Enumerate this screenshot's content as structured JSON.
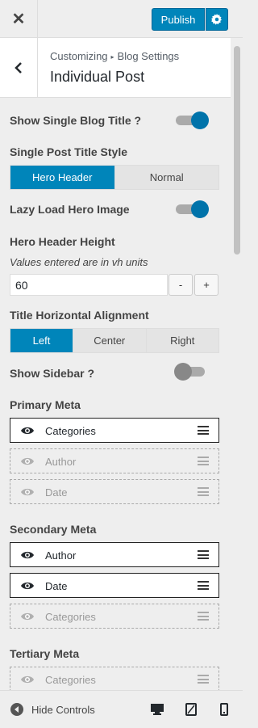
{
  "topbar": {
    "close_icon": "close-icon",
    "publish_label": "Publish",
    "settings_icon": "gear-icon",
    "accent_color": "#0085ba"
  },
  "header": {
    "breadcrumb_root": "Customizing",
    "breadcrumb_section": "Blog Settings",
    "title": "Individual Post",
    "back_icon": "chevron-left-icon"
  },
  "controls": {
    "show_single_blog_title": {
      "label": "Show Single Blog Title ?",
      "value": true
    },
    "single_post_title_style": {
      "label": "Single Post Title Style",
      "options": [
        "Hero Header",
        "Normal"
      ],
      "selected": "Hero Header"
    },
    "lazy_load_hero_image": {
      "label": "Lazy Load Hero Image",
      "value": true
    },
    "hero_header_height": {
      "label": "Hero Header Height",
      "description": "Values entered are in vh units",
      "value": "60",
      "decrement": "-",
      "increment": "+"
    },
    "title_horizontal_alignment": {
      "label": "Title Horizontal Alignment",
      "options": [
        "Left",
        "Center",
        "Right"
      ],
      "selected": "Left"
    },
    "show_sidebar": {
      "label": "Show Sidebar ?",
      "value": false
    }
  },
  "meta": {
    "primary": {
      "label": "Primary Meta",
      "items": [
        {
          "label": "Categories",
          "enabled": true
        },
        {
          "label": "Author",
          "enabled": false
        },
        {
          "label": "Date",
          "enabled": false
        }
      ]
    },
    "secondary": {
      "label": "Secondary Meta",
      "items": [
        {
          "label": "Author",
          "enabled": true
        },
        {
          "label": "Date",
          "enabled": true
        },
        {
          "label": "Categories",
          "enabled": false
        }
      ]
    },
    "tertiary": {
      "label": "Tertiary Meta",
      "items": [
        {
          "label": "Categories",
          "enabled": false
        }
      ]
    }
  },
  "footer": {
    "hide_controls_label": "Hide Controls",
    "devices": [
      "desktop-icon",
      "tablet-icon",
      "mobile-icon"
    ],
    "active_device": "desktop-icon"
  }
}
